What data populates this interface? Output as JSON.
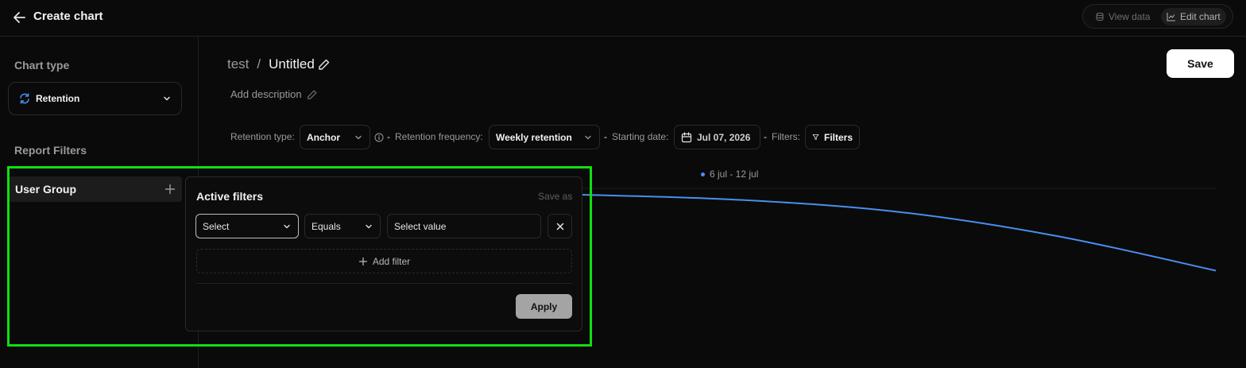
{
  "topbar": {
    "title": "Create chart",
    "view_data_label": "View data",
    "edit_chart_label": "Edit chart"
  },
  "sidebar": {
    "chart_type_heading": "Chart type",
    "chart_type_value": "Retention",
    "report_filters_heading": "Report Filters",
    "user_group_label": "User Group"
  },
  "header": {
    "breadcrumb_parent": "test",
    "breadcrumb_separator": "/",
    "chart_name": "Untitled",
    "save_label": "Save",
    "add_description_label": "Add description"
  },
  "controls": {
    "retention_type_label": "Retention type:",
    "retention_type_value": "Anchor",
    "dash": "-",
    "retention_frequency_label": "Retention frequency:",
    "retention_frequency_value": "Weekly retention",
    "starting_date_label": "Starting date:",
    "starting_date_value": "Jul 07, 2026",
    "filters_label": "Filters:",
    "filters_button_label": "Filters"
  },
  "chart": {
    "legend_label": "6 jul - 12 jul",
    "series_color": "#4a8ef0"
  },
  "filter_popover": {
    "title": "Active filters",
    "save_as_label": "Save as",
    "field_select": "Select",
    "operator_select": "Equals",
    "value_placeholder": "Select value",
    "add_filter_label": "Add filter",
    "apply_label": "Apply"
  },
  "chart_data": {
    "type": "line",
    "series": [
      {
        "name": "6 jul - 12 jul",
        "values": [
          100,
          97,
          90,
          76,
          56
        ]
      }
    ]
  }
}
